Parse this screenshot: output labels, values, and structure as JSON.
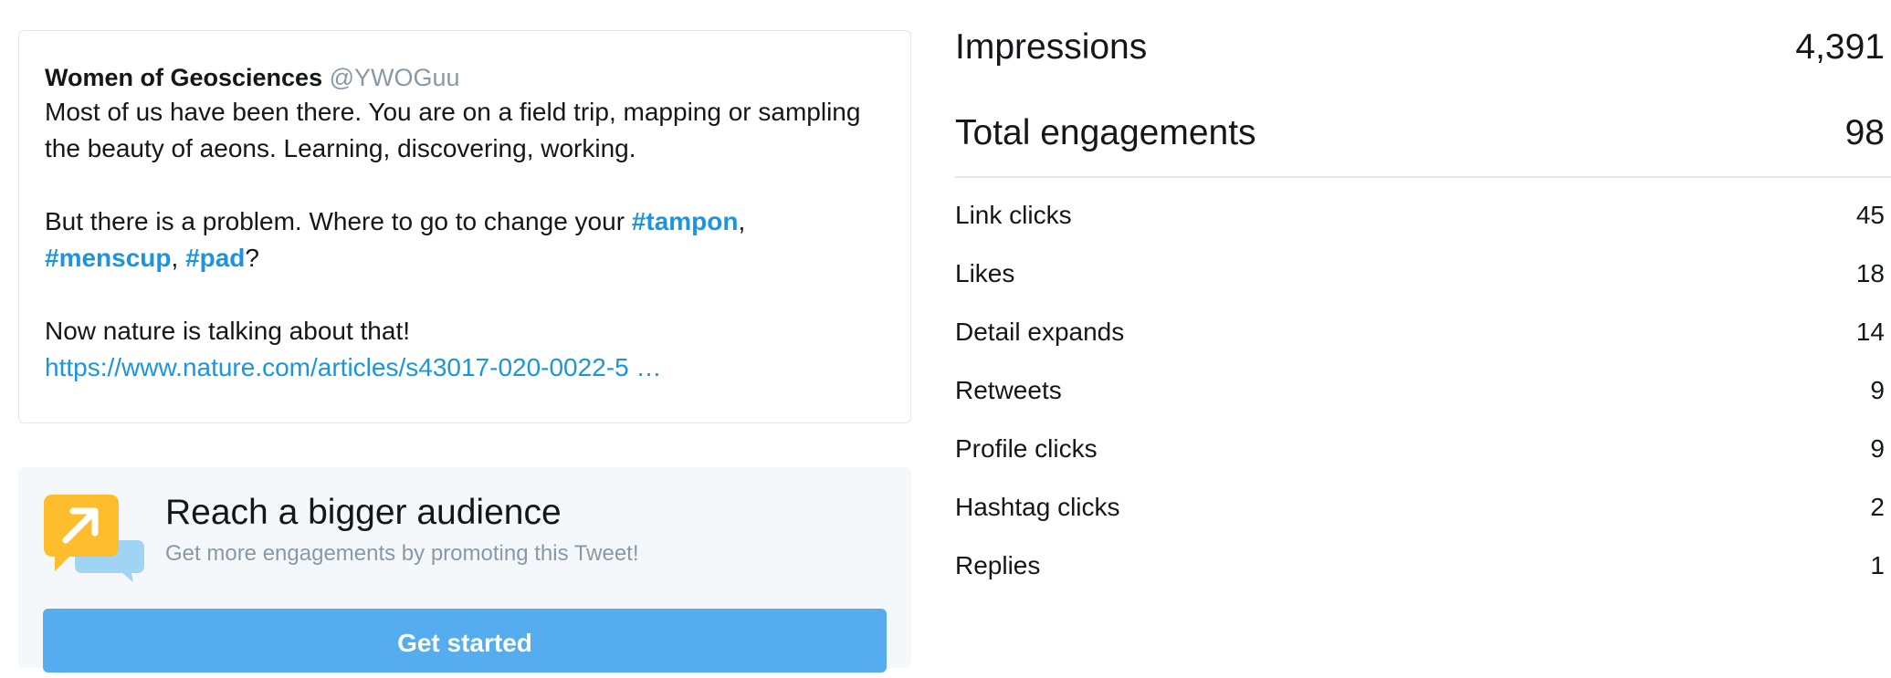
{
  "tweet": {
    "author_name": "Women of Geosciences",
    "author_handle": "@YWOGuu",
    "para1": "Most of us have been there. You are on a field trip, mapping or sampling the beauty of aeons. Learning, discovering, working.",
    "para2_prefix": "But there is a problem. Where to go to change your ",
    "hashtag_tampon": "#tampon",
    "comma1": ",",
    "hashtag_menscup": "#menscup",
    "comma2": ", ",
    "hashtag_pad": "#pad",
    "para2_suffix": "?",
    "para3": "Now nature is talking about that!",
    "link": "https://www.nature.com/articles/s43017-020-0022-5 …"
  },
  "promote": {
    "title": "Reach a bigger audience",
    "subtitle": "Get more engagements by promoting this Tweet!",
    "button_label": "Get started",
    "button_color": "#55acee",
    "icon": "promote-speech-bubble-arrow-icon"
  },
  "metrics": {
    "impressions_label": "Impressions",
    "impressions_value": "4,391",
    "engagements_label": "Total engagements",
    "engagements_value": "98",
    "items": [
      {
        "label": "Link clicks",
        "value": "45"
      },
      {
        "label": "Likes",
        "value": "18"
      },
      {
        "label": "Detail expands",
        "value": "14"
      },
      {
        "label": "Retweets",
        "value": "9"
      },
      {
        "label": "Profile clicks",
        "value": "9"
      },
      {
        "label": "Hashtag clicks",
        "value": "2"
      },
      {
        "label": "Replies",
        "value": "1"
      }
    ]
  },
  "colors": {
    "hashtag": "#1b95e0",
    "muted": "#8899a6",
    "text": "#14171a"
  }
}
